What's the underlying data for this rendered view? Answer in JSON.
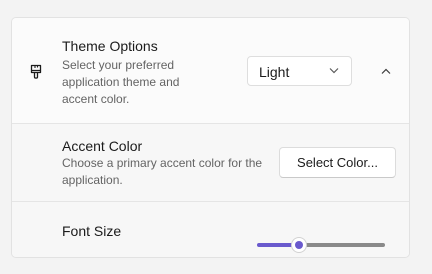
{
  "theme_options": {
    "icon": "paint-brush-icon",
    "title": "Theme Options",
    "description": "Select your preferred application theme and accent color.",
    "theme_select": {
      "selected": "Light"
    },
    "collapse_icon": "chevron-up-icon"
  },
  "accent_color": {
    "title": "Accent Color",
    "description": "Choose a primary accent color for the application.",
    "button_label": "Select Color..."
  },
  "font_size": {
    "title": "Font Size",
    "slider_value_fraction": 0.33
  },
  "colors": {
    "accent": "#6a5acd",
    "track_inactive": "#8a8a8a"
  }
}
